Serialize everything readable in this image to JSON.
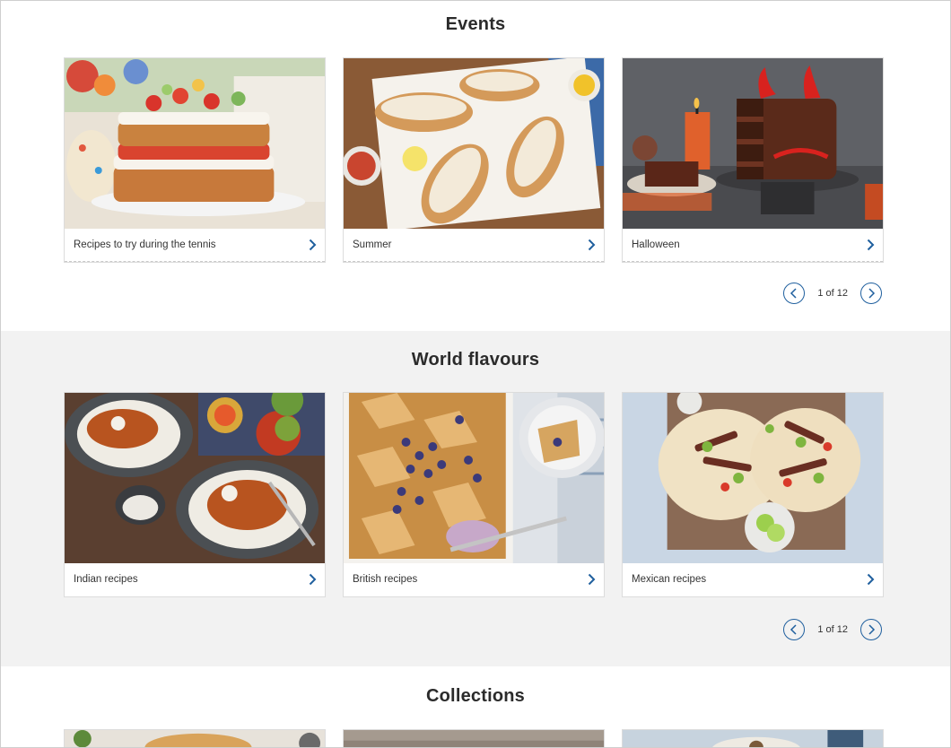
{
  "sections": [
    {
      "title": "Events",
      "cards": [
        {
          "caption": "Recipes to try during the tennis"
        },
        {
          "caption": "Summer"
        },
        {
          "caption": "Halloween"
        }
      ],
      "pager": {
        "text": "1 of 12"
      }
    },
    {
      "title": "World flavours",
      "cards": [
        {
          "caption": "Indian recipes"
        },
        {
          "caption": "British recipes"
        },
        {
          "caption": "Mexican recipes"
        }
      ],
      "pager": {
        "text": "1 of 12"
      }
    },
    {
      "title": "Collections"
    }
  ],
  "icons": {
    "card_arrow": "chevron-right-icon",
    "prev": "chevron-left-circle-icon",
    "next": "chevron-right-circle-icon"
  },
  "colors": {
    "accent": "#1f5f9e",
    "band_background": "#f2f2f2"
  }
}
